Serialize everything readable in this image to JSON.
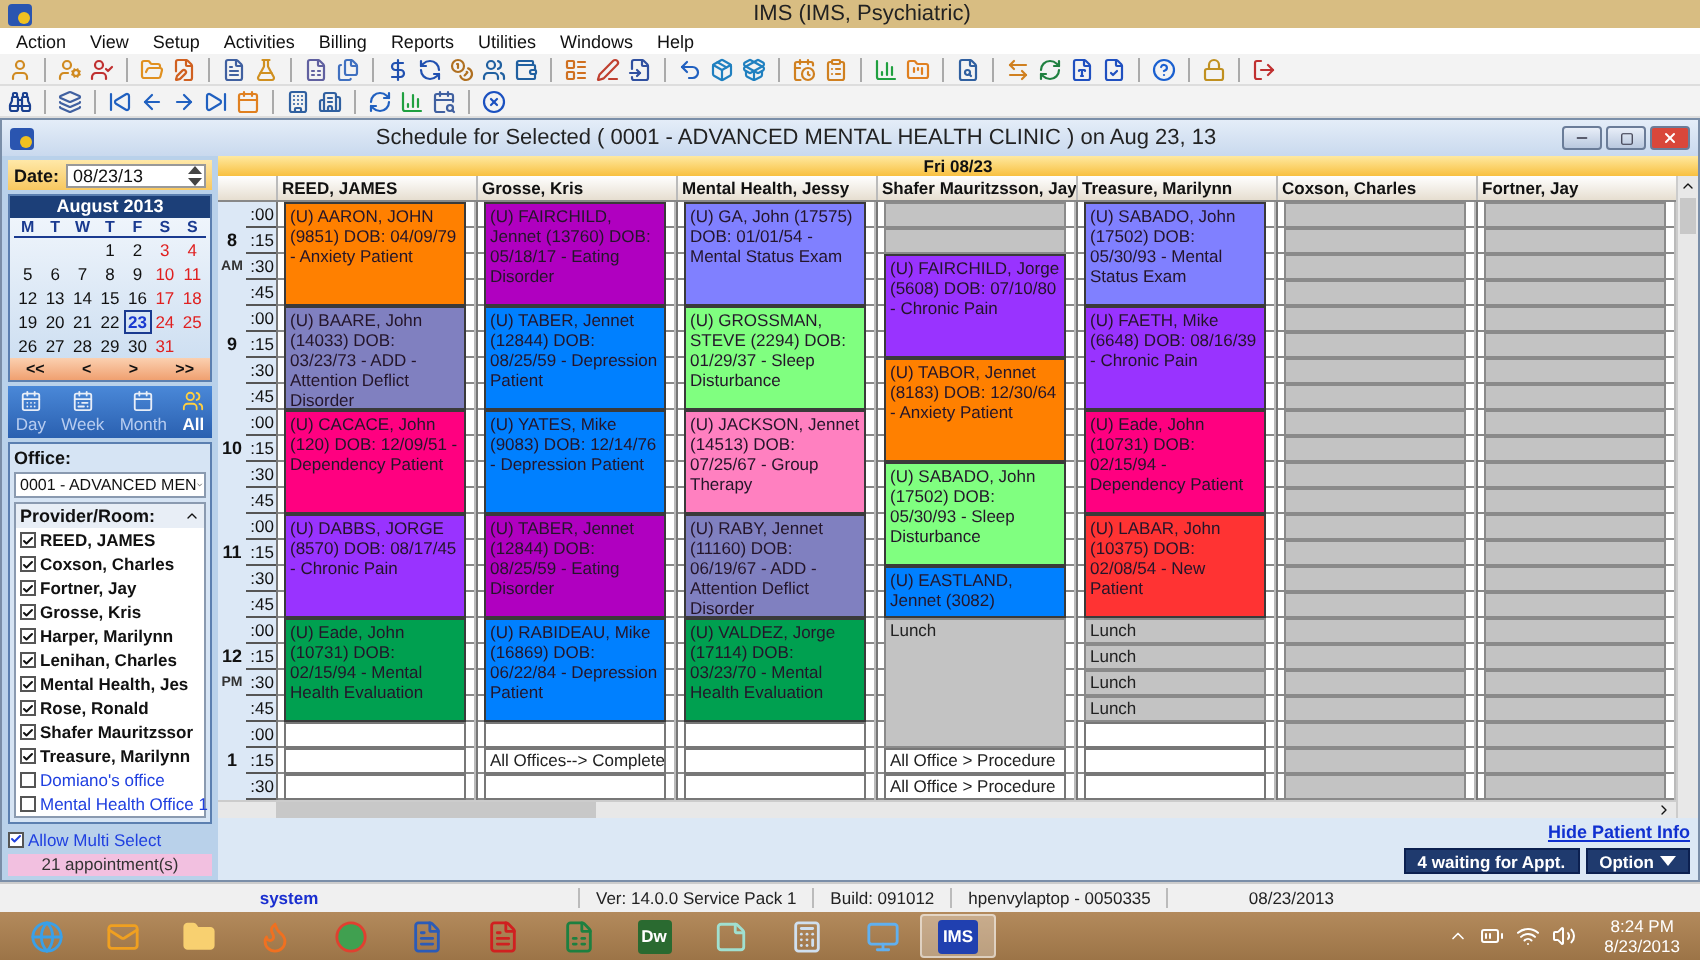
{
  "window": {
    "title": "IMS (IMS, Psychiatric)"
  },
  "menu": [
    "Action",
    "View",
    "Setup",
    "Activities",
    "Billing",
    "Reports",
    "Utilities",
    "Windows",
    "Help"
  ],
  "sidebar": {
    "date_label": "Date:",
    "date_value": "08/23/13",
    "calendar": {
      "title": "August 2013",
      "weekdays": [
        "M",
        "T",
        "W",
        "T",
        "F",
        "S",
        "S"
      ],
      "weeks": [
        [
          {
            "label": "1",
            "weekend": false,
            "selected": false
          },
          {
            "label": "2",
            "weekend": false,
            "selected": false
          },
          {
            "label": "3",
            "weekend": true,
            "selected": false
          },
          {
            "label": "4",
            "weekend": true,
            "selected": false
          }
        ],
        [
          {
            "label": "5",
            "weekend": false,
            "selected": false
          },
          {
            "label": "6",
            "weekend": false,
            "selected": false
          },
          {
            "label": "7",
            "weekend": false,
            "selected": false
          },
          {
            "label": "8",
            "weekend": false,
            "selected": false
          },
          {
            "label": "9",
            "weekend": false,
            "selected": false
          },
          {
            "label": "10",
            "weekend": true,
            "selected": false
          },
          {
            "label": "11",
            "weekend": true,
            "selected": false
          }
        ],
        [
          {
            "label": "12",
            "weekend": false,
            "selected": false
          },
          {
            "label": "13",
            "weekend": false,
            "selected": false
          },
          {
            "label": "14",
            "weekend": false,
            "selected": false
          },
          {
            "label": "15",
            "weekend": false,
            "selected": false
          },
          {
            "label": "16",
            "weekend": false,
            "selected": false
          },
          {
            "label": "17",
            "weekend": true,
            "selected": false
          },
          {
            "label": "18",
            "weekend": true,
            "selected": false
          }
        ],
        [
          {
            "label": "19",
            "weekend": false,
            "selected": false
          },
          {
            "label": "20",
            "weekend": false,
            "selected": false
          },
          {
            "label": "21",
            "weekend": false,
            "selected": false
          },
          {
            "label": "22",
            "weekend": false,
            "selected": false
          },
          {
            "label": "23",
            "weekend": false,
            "selected": true
          },
          {
            "label": "24",
            "weekend": true,
            "selected": false
          },
          {
            "label": "25",
            "weekend": true,
            "selected": false
          }
        ],
        [
          {
            "label": "26",
            "weekend": false,
            "selected": false
          },
          {
            "label": "27",
            "weekend": false,
            "selected": false
          },
          {
            "label": "28",
            "weekend": false,
            "selected": false
          },
          {
            "label": "29",
            "weekend": false,
            "selected": false
          },
          {
            "label": "30",
            "weekend": false,
            "selected": false
          },
          {
            "label": "31",
            "weekend": true,
            "selected": false
          }
        ]
      ],
      "nav": [
        "<<",
        "<",
        ">",
        ">>"
      ]
    },
    "views": [
      {
        "label": "Day",
        "selected": false
      },
      {
        "label": "Week",
        "selected": false
      },
      {
        "label": "Month",
        "selected": false
      },
      {
        "label": "All",
        "selected": true
      }
    ],
    "office_label": "Office:",
    "office_value": "0001 - ADVANCED MEN",
    "provider_header": "Provider/Room:",
    "providers": [
      {
        "name": "REED, JAMES",
        "checked": true,
        "kind": "provider"
      },
      {
        "name": "Coxson, Charles",
        "checked": true,
        "kind": "provider"
      },
      {
        "name": "Fortner, Jay",
        "checked": true,
        "kind": "provider"
      },
      {
        "name": "Grosse, Kris",
        "checked": true,
        "kind": "provider"
      },
      {
        "name": "Harper, Marilynn",
        "checked": true,
        "kind": "provider"
      },
      {
        "name": "Lenihan, Charles",
        "checked": true,
        "kind": "provider"
      },
      {
        "name": "Mental Health, Jes",
        "checked": true,
        "kind": "provider"
      },
      {
        "name": "Rose, Ronald",
        "checked": true,
        "kind": "provider"
      },
      {
        "name": "Shafer Mauritzssor",
        "checked": true,
        "kind": "provider"
      },
      {
        "name": "Treasure, Marilynn",
        "checked": true,
        "kind": "provider"
      },
      {
        "name": "Domiano's office",
        "checked": false,
        "kind": "room"
      },
      {
        "name": "Mental Health Office 1",
        "checked": false,
        "kind": "room"
      }
    ],
    "multi_select": {
      "label": "Allow Multi Select",
      "checked": true
    },
    "count": "21 appointment(s)"
  },
  "schedule": {
    "title": "Schedule for Selected ( 0001 - ADVANCED MENTAL HEALTH CLINIC  ) on Aug 23, 13",
    "day": "Fri 08/23",
    "times": [
      {
        "hour": "8",
        "period": "AM",
        "minutes": [
          ":00",
          ":15",
          ":30",
          ":45"
        ]
      },
      {
        "hour": "9",
        "minutes": [
          ":00",
          ":15",
          ":30",
          ":45"
        ]
      },
      {
        "hour": "10",
        "minutes": [
          ":00",
          ":15",
          ":30",
          ":45"
        ]
      },
      {
        "hour": "11",
        "minutes": [
          ":00",
          ":15",
          ":30",
          ":45"
        ]
      },
      {
        "hour": "12",
        "period": "PM",
        "minutes": [
          ":00",
          ":15",
          ":30",
          ":45"
        ]
      },
      {
        "hour": "1",
        "minutes": [
          ":00",
          ":15",
          ":30"
        ]
      }
    ],
    "columns": [
      {
        "provider": "REED, JAMES",
        "cells": [
          {
            "kind": "appointment",
            "color": "#ff8000",
            "text": "(U) AARON, JOHN (9851)  DOB: 04/09/79 -  Anxiety Patient"
          },
          {
            "kind": "continued"
          },
          {
            "kind": "continued"
          },
          {
            "kind": "continued"
          },
          {
            "kind": "appointment",
            "color": "#8080c0",
            "text": "(U) BAARE, John (14033)  DOB: 03/23/73 -  ADD - Attention Deflict Disorder"
          },
          {
            "kind": "continued"
          },
          {
            "kind": "continued"
          },
          {
            "kind": "continued"
          },
          {
            "kind": "appointment",
            "color": "#ff0080",
            "text": "(U) CACACE, John (120)  DOB: 12/09/51 - Dependency Patient"
          },
          {
            "kind": "continued"
          },
          {
            "kind": "continued"
          },
          {
            "kind": "continued"
          },
          {
            "kind": "appointment",
            "color": "#9933ff",
            "text": "(U) DABBS, JORGE (8570)  DOB: 08/17/45 -  Chronic Pain"
          },
          {
            "kind": "continued"
          },
          {
            "kind": "continued"
          },
          {
            "kind": "continued"
          },
          {
            "kind": "appointment",
            "color": "#00a050",
            "text": "(U) Eade, John  (10731) DOB: 02/15/94 -  Mental Health Evaluation"
          },
          {
            "kind": "continued"
          },
          {
            "kind": "continued"
          },
          {
            "kind": "continued"
          },
          {
            "kind": "open"
          },
          {
            "kind": "open"
          },
          {
            "kind": "open"
          }
        ]
      },
      {
        "provider": "Grosse, Kris",
        "cells": [
          {
            "kind": "appointment",
            "color": "#b000c0",
            "text": "(U) FAIRCHILD, Jennet (13760)  DOB: 05/18/17 -  Eating Disorder"
          },
          {
            "kind": "continued"
          },
          {
            "kind": "continued"
          },
          {
            "kind": "continued"
          },
          {
            "kind": "appointment",
            "color": "#0080ff",
            "text": "(U) TABER, Jennet (12844)  DOB: 08/25/59 -  Depression Patient"
          },
          {
            "kind": "continued"
          },
          {
            "kind": "continued"
          },
          {
            "kind": "continued"
          },
          {
            "kind": "appointment",
            "color": "#0080ff",
            "text": "(U) YATES, Mike  (9083) DOB: 12/14/76 - Depression Patient"
          },
          {
            "kind": "continued"
          },
          {
            "kind": "continued"
          },
          {
            "kind": "continued"
          },
          {
            "kind": "appointment",
            "color": "#b000c0",
            "text": "(U) TABER, Jennet (12844)  DOB: 08/25/59 -  Eating Disorder"
          },
          {
            "kind": "continued"
          },
          {
            "kind": "continued"
          },
          {
            "kind": "continued"
          },
          {
            "kind": "appointment",
            "color": "#0080ff",
            "text": "(U) RABIDEAU, Mike (16869)  DOB: 06/22/84 -  Depression Patient"
          },
          {
            "kind": "continued"
          },
          {
            "kind": "continued"
          },
          {
            "kind": "continued"
          },
          {
            "kind": "open"
          },
          {
            "kind": "open",
            "text": "All Offices-->  Complete"
          },
          {
            "kind": "open"
          }
        ]
      },
      {
        "provider": "Mental Health, Jessy",
        "cells": [
          {
            "kind": "appointment",
            "color": "#8080ff",
            "text": "(U) GA, John  (17575) DOB: 01/01/54 -  Mental Status Exam"
          },
          {
            "kind": "continued"
          },
          {
            "kind": "continued"
          },
          {
            "kind": "continued"
          },
          {
            "kind": "appointment",
            "color": "#80ff80",
            "text": "(U) GROSSMAN, STEVE (2294)  DOB: 01/29/37 -  Sleep Disturbance"
          },
          {
            "kind": "continued"
          },
          {
            "kind": "continued"
          },
          {
            "kind": "continued"
          },
          {
            "kind": "appointment",
            "color": "#ff80c0",
            "text": "(U) JACKSON, Jennet (14513)  DOB: 07/25/67 -  Group Therapy"
          },
          {
            "kind": "continued"
          },
          {
            "kind": "continued"
          },
          {
            "kind": "continued"
          },
          {
            "kind": "appointment",
            "color": "#8080c0",
            "text": "(U) RABY, Jennet (11160)  DOB: 06/19/67 -  ADD - Attention Deflict Disorder"
          },
          {
            "kind": "continued"
          },
          {
            "kind": "continued"
          },
          {
            "kind": "continued"
          },
          {
            "kind": "appointment",
            "color": "#00a050",
            "text": "(U) VALDEZ, Jorge (17114)  DOB: 03/23/70 -  Mental Health Evaluation"
          },
          {
            "kind": "continued"
          },
          {
            "kind": "continued"
          },
          {
            "kind": "continued"
          },
          {
            "kind": "open"
          },
          {
            "kind": "open"
          },
          {
            "kind": "open"
          }
        ]
      },
      {
        "provider": "Shafer Mauritzsson, Jay",
        "cells": [
          {
            "kind": "blocked"
          },
          {
            "kind": "blocked"
          },
          {
            "kind": "appointment",
            "color": "#9933ff",
            "text": "(U) FAIRCHILD, Jorge (5608)  DOB: 07/10/80 -  Chronic Pain"
          },
          {
            "kind": "continued"
          },
          {
            "kind": "continued"
          },
          {
            "kind": "continued"
          },
          {
            "kind": "appointment",
            "color": "#ff8000",
            "text": "(U) TABOR, Jennet (8183)  DOB: 12/30/64 -  Anxiety Patient"
          },
          {
            "kind": "continued"
          },
          {
            "kind": "continued"
          },
          {
            "kind": "continued"
          },
          {
            "kind": "appointment",
            "color": "#80ff80",
            "text": "(U) SABADO, John (17502)  DOB: 05/30/93 -  Sleep Disturbance"
          },
          {
            "kind": "continued"
          },
          {
            "kind": "continued"
          },
          {
            "kind": "continued"
          },
          {
            "kind": "appointment",
            "color": "#0080ff",
            "text": "(U) EASTLAND, Jennet (3082)"
          },
          {
            "kind": "continued"
          },
          {
            "kind": "blocked",
            "text": "Lunch"
          },
          {
            "kind": "continued"
          },
          {
            "kind": "continued"
          },
          {
            "kind": "continued"
          },
          {
            "kind": "continued"
          },
          {
            "kind": "open",
            "text": "All Office > Procedure"
          },
          {
            "kind": "open",
            "text": "All Office > Procedure"
          }
        ]
      },
      {
        "provider": "Treasure, Marilynn",
        "cells": [
          {
            "kind": "appointment",
            "color": "#8080ff",
            "text": "(U) SABADO, John (17502)  DOB: 05/30/93 -  Mental Status Exam"
          },
          {
            "kind": "continued"
          },
          {
            "kind": "continued"
          },
          {
            "kind": "continued"
          },
          {
            "kind": "appointment",
            "color": "#9933ff",
            "text": "(U) FAETH, Mike  (6648) DOB: 08/16/39 - Chronic Pain"
          },
          {
            "kind": "continued"
          },
          {
            "kind": "continued"
          },
          {
            "kind": "continued"
          },
          {
            "kind": "appointment",
            "color": "#ff0080",
            "text": "(U) Eade, John  (10731) DOB: 02/15/94 - Dependency Patient"
          },
          {
            "kind": "continued"
          },
          {
            "kind": "continued"
          },
          {
            "kind": "continued"
          },
          {
            "kind": "appointment",
            "color": "#ff3333",
            "text": "(U) LABAR, John (10375)  DOB: 02/08/54 -  New Patient"
          },
          {
            "kind": "continued"
          },
          {
            "kind": "continued"
          },
          {
            "kind": "continued"
          },
          {
            "kind": "blocked",
            "text": "Lunch"
          },
          {
            "kind": "blocked",
            "text": "Lunch"
          },
          {
            "kind": "blocked",
            "text": "Lunch"
          },
          {
            "kind": "blocked",
            "text": "Lunch"
          },
          {
            "kind": "open"
          },
          {
            "kind": "open"
          },
          {
            "kind": "open"
          }
        ]
      },
      {
        "provider": "Coxson, Charles",
        "cells": [
          {
            "kind": "blocked"
          },
          {
            "kind": "blocked"
          },
          {
            "kind": "blocked"
          },
          {
            "kind": "blocked"
          },
          {
            "kind": "blocked"
          },
          {
            "kind": "blocked"
          },
          {
            "kind": "blocked"
          },
          {
            "kind": "blocked"
          },
          {
            "kind": "blocked"
          },
          {
            "kind": "blocked"
          },
          {
            "kind": "blocked"
          },
          {
            "kind": "blocked"
          },
          {
            "kind": "blocked"
          },
          {
            "kind": "blocked"
          },
          {
            "kind": "blocked"
          },
          {
            "kind": "blocked"
          },
          {
            "kind": "blocked"
          },
          {
            "kind": "blocked"
          },
          {
            "kind": "blocked"
          },
          {
            "kind": "blocked"
          },
          {
            "kind": "blocked"
          },
          {
            "kind": "blocked"
          },
          {
            "kind": "blocked"
          }
        ]
      },
      {
        "provider": "Fortner, Jay",
        "cells": [
          {
            "kind": "blocked"
          },
          {
            "kind": "blocked"
          },
          {
            "kind": "blocked"
          },
          {
            "kind": "blocked"
          },
          {
            "kind": "blocked"
          },
          {
            "kind": "blocked"
          },
          {
            "kind": "blocked"
          },
          {
            "kind": "blocked"
          },
          {
            "kind": "blocked"
          },
          {
            "kind": "blocked"
          },
          {
            "kind": "blocked"
          },
          {
            "kind": "blocked"
          },
          {
            "kind": "blocked"
          },
          {
            "kind": "blocked"
          },
          {
            "kind": "blocked"
          },
          {
            "kind": "blocked"
          },
          {
            "kind": "blocked"
          },
          {
            "kind": "blocked"
          },
          {
            "kind": "blocked"
          },
          {
            "kind": "blocked"
          },
          {
            "kind": "blocked"
          },
          {
            "kind": "blocked"
          },
          {
            "kind": "blocked"
          }
        ]
      }
    ],
    "hide_link": "Hide Patient Info",
    "buttons": [
      {
        "label": "4 waiting for Appt.",
        "kind": "plain"
      },
      {
        "label": "Option",
        "kind": "menu"
      }
    ]
  },
  "status_bar": [
    {
      "text": "system",
      "kind": "user"
    },
    {
      "text": "Ver: 14.0.0 Service Pack 1",
      "kind": "plain"
    },
    {
      "text": "Build: 091012",
      "kind": "plain"
    },
    {
      "text": "hpenvylaptop - 0050335",
      "kind": "plain"
    },
    {
      "text": "08/23/2013",
      "kind": "date"
    }
  ],
  "taskbar": {
    "labeled_apps": [
      {
        "label": "Dw",
        "selected": false
      },
      {
        "label": "IMS",
        "selected": true
      }
    ],
    "time": "8:24 PM",
    "date": "8/23/2013"
  }
}
